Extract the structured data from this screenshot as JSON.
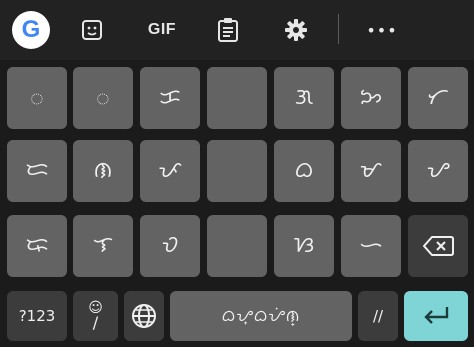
{
  "toolbar": {
    "google_letter": "G",
    "gif_label": "GIF",
    "more_label": "•••",
    "brand_colors": {
      "blue": "#4285F4",
      "red": "#EA4335",
      "yellow": "#FBBC05",
      "green": "#34A853"
    }
  },
  "keyboard": {
    "rows": [
      [
        "ᜀ",
        "ᜀ",
        "ᜃ",
        "",
        "ᜄ",
        "ᜅ",
        "ᜆ"
      ],
      [
        "ᜇ",
        "ᜈ",
        "ᜉ",
        "",
        "ᜊ",
        "ᜋ",
        "ᜌ"
      ],
      [
        "ᜍ",
        "ᜎ",
        "ᜏ",
        "",
        "ᜐ",
        "ᜑ"
      ]
    ],
    "symbols_label": "?123",
    "emoji_top": "☺",
    "emoji_bottom": "/",
    "space_label": "ᜊᜌ᜔ᜊᜌᜒᜈ᜔",
    "slash_label": "//",
    "enter_symbol": "↵",
    "colors": {
      "key": "#636363",
      "key_dark": "#3c3c3c",
      "enter": "#7fd4d6",
      "background": "#1b1b1b"
    }
  }
}
